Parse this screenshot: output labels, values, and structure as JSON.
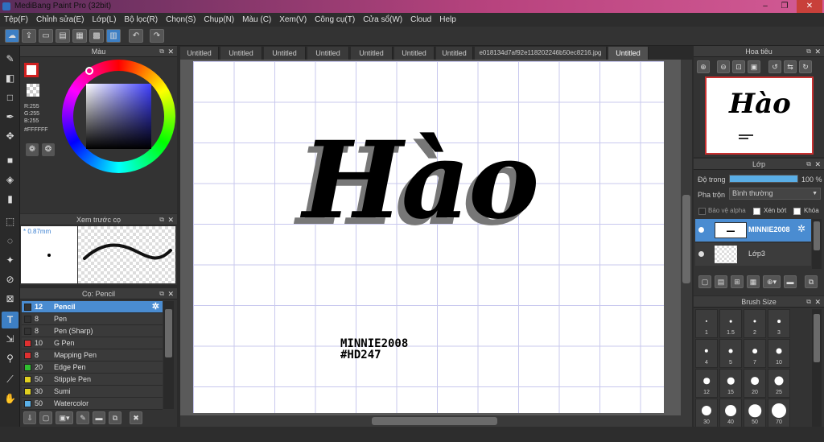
{
  "window": {
    "title": "MediBang Paint Pro (32bit)",
    "min": "–",
    "max": "❐",
    "close": "✕"
  },
  "menu": [
    "Tệp(F)",
    "Chỉnh sửa(E)",
    "Lớp(L)",
    "Bộ lọc(R)",
    "Chọn(S)",
    "Chụp(N)",
    "Màu (C)",
    "Xem(V)",
    "Công cụ(T)",
    "Cửa sổ(W)",
    "Cloud",
    "Help"
  ],
  "color_panel": {
    "title": "Màu",
    "r": "R:255",
    "g": "G:255",
    "b": "B:255",
    "hex": "#FFFFFF"
  },
  "brush_preview": {
    "title": "Xem trước cọ",
    "size": "* 0.87mm"
  },
  "brush_panel": {
    "title": "Cọ: Pencil",
    "items": [
      {
        "size": "12",
        "name": "Pencil",
        "color": "#333333"
      },
      {
        "size": "8",
        "name": "Pen",
        "color": "#333333"
      },
      {
        "size": "8",
        "name": "Pen (Sharp)",
        "color": "#333333"
      },
      {
        "size": "10",
        "name": "G Pen",
        "color": "#e03030"
      },
      {
        "size": "8",
        "name": "Mapping Pen",
        "color": "#e03030"
      },
      {
        "size": "20",
        "name": "Edge Pen",
        "color": "#30c030"
      },
      {
        "size": "50",
        "name": "Stipple Pen",
        "color": "#e0d020"
      },
      {
        "size": "30",
        "name": "Sumi",
        "color": "#e0d020"
      },
      {
        "size": "50",
        "name": "Watercolor",
        "color": "#5ab0e8"
      }
    ]
  },
  "doc_tabs": [
    "Untitled",
    "Untitled",
    "Untitled",
    "Untitled",
    "Untitled",
    "Untitled",
    "Untitled",
    "e018134d7af92e118202246b50ec8216.jpg",
    "Untitled"
  ],
  "canvas": {
    "title_text": "Hào",
    "signature_line1": "MINNIE2008",
    "signature_line2": "#HD247"
  },
  "navigator": {
    "title": "Hoa tiêu"
  },
  "layer_panel": {
    "title": "Lớp",
    "opacity_label": "Độ trong",
    "opacity_value": "100 %",
    "opacity": 1.0,
    "blend_label": "Pha trộn",
    "blend_value": "Bình thường",
    "protect_alpha": "Bảo vệ alpha",
    "clip": "Xén bớt",
    "lock": "Khóa",
    "layers": [
      {
        "name": "MINNIE2008",
        "selected": true
      },
      {
        "name": "Lớp3",
        "selected": false
      }
    ]
  },
  "brush_size": {
    "title": "Brush Size",
    "sizes": [
      "1",
      "1.5",
      "2",
      "3",
      "4",
      "5",
      "7",
      "10",
      "12",
      "15",
      "20",
      "25",
      "30",
      "40",
      "50",
      "70"
    ]
  },
  "colors": {
    "accent": "#4a8cd1",
    "bg": "#2b2b2b"
  }
}
